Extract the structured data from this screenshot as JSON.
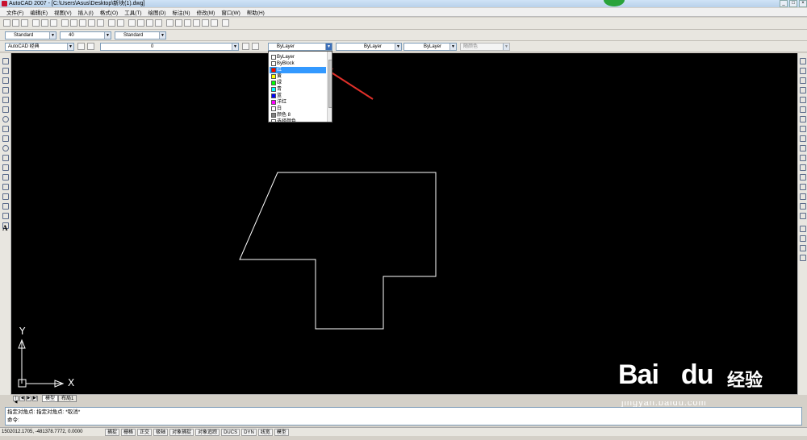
{
  "window": {
    "title": "AutoCAD 2007 - [C:\\Users\\Asus\\Desktop\\新块(1).dwg]",
    "buttons": [
      "_",
      "□",
      "×"
    ]
  },
  "menubar": {
    "items": [
      "文件(F)",
      "编辑(E)",
      "视图(V)",
      "插入(I)",
      "格式(O)",
      "工具(T)",
      "绘图(D)",
      "标注(N)",
      "修改(M)",
      "窗口(W)",
      "帮助(H)"
    ]
  },
  "styles": {
    "text_style": "Standard",
    "dim_style": "40",
    "table_style": "Standard",
    "workspace": "AutoCAD 经典",
    "layer": "0"
  },
  "properties": {
    "color": "ByLayer",
    "linetype": "ByLayer",
    "lineweight": "ByLayer",
    "plotstyle": "随颜色"
  },
  "color_dropdown": {
    "items": [
      {
        "label": "ByLayer",
        "color": "#ffffff"
      },
      {
        "label": "ByBlock",
        "color": "#ffffff"
      },
      {
        "label": "红",
        "color": "#ff0000"
      },
      {
        "label": "黄",
        "color": "#ffff00"
      },
      {
        "label": "绿",
        "color": "#00ff00"
      },
      {
        "label": "青",
        "color": "#00ffff"
      },
      {
        "label": "蓝",
        "color": "#0000ff"
      },
      {
        "label": "洋红",
        "color": "#ff00ff"
      },
      {
        "label": "白",
        "color": "#ffffff"
      },
      {
        "label": "颜色 8",
        "color": "#808080"
      },
      {
        "label": "选择颜色...",
        "color": "#ffffff"
      }
    ],
    "selected": "红"
  },
  "ucs": {
    "x_label": "X",
    "y_label": "Y"
  },
  "layout_tabs": {
    "model": "模型",
    "layout1": "布局1"
  },
  "command": {
    "history": "指定对角点: 指定对角点: *取消*",
    "prompt": "命令:"
  },
  "status": {
    "coords": "1502012.1705, -481378.7772, 0.0000",
    "buttons": [
      "捕捉",
      "栅格",
      "正交",
      "极轴",
      "对象捕捉",
      "对象追踪",
      "DUCS",
      "DYN",
      "线宽",
      "模型"
    ]
  },
  "watermark": {
    "brand": "Bai",
    "brand2": "du",
    "cn": "经验",
    "url": "jingyan.baidu.com"
  },
  "colors": {
    "canvas": "#000000",
    "arrow": "#e0302a",
    "selection": "#3399ff"
  }
}
